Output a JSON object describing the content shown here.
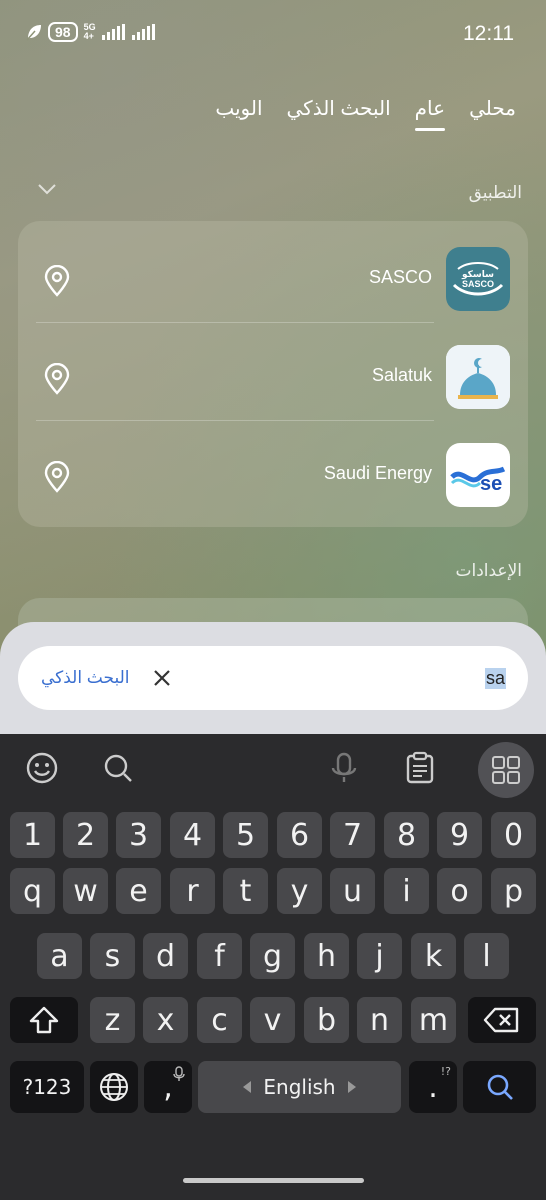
{
  "status_bar": {
    "time": "12:11",
    "battery": "98",
    "network": "5G"
  },
  "tabs": [
    {
      "label": "محلي",
      "active": false
    },
    {
      "label": "عام",
      "active": true
    },
    {
      "label": "البحث الذكي",
      "active": false
    },
    {
      "label": "الويب",
      "active": false
    }
  ],
  "sections": {
    "apps_label": "التطبيق",
    "settings_label": "الإعدادات"
  },
  "apps": [
    {
      "name": "SASCO",
      "icon": "sasco-app-icon",
      "icon_text": "ساسكو SASCO"
    },
    {
      "name": "Salatuk",
      "icon": "salatuk-app-icon"
    },
    {
      "name": "Saudi Energy",
      "icon": "saudi-energy-app-icon",
      "icon_text": "se"
    }
  ],
  "search": {
    "query": "sa",
    "smart_search_label": "البحث الذكي"
  },
  "keyboard": {
    "numbers": [
      "1",
      "2",
      "3",
      "4",
      "5",
      "6",
      "7",
      "8",
      "9",
      "0"
    ],
    "row1": [
      "q",
      "w",
      "e",
      "r",
      "t",
      "y",
      "u",
      "i",
      "o",
      "p"
    ],
    "row2": [
      "a",
      "s",
      "d",
      "f",
      "g",
      "h",
      "j",
      "k",
      "l"
    ],
    "row3": [
      "z",
      "x",
      "c",
      "v",
      "b",
      "n",
      "m"
    ],
    "symbols_key": "?123",
    "comma": ",",
    "period": ".",
    "period_sub": "!?",
    "space_label": "English"
  },
  "colors": {
    "accent": "#3a6fd0",
    "keyboard_bg": "#2b2b2d",
    "key_bg": "#48484b"
  }
}
